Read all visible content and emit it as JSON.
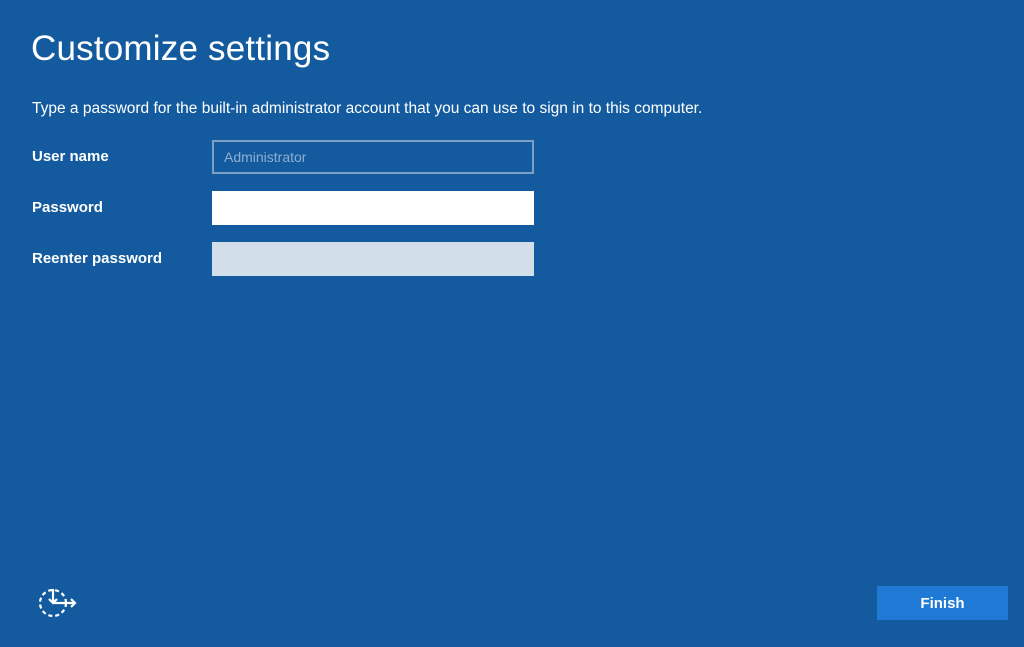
{
  "page": {
    "title": "Customize settings",
    "description": "Type a password for the built-in administrator account that you can use to sign in to this computer."
  },
  "form": {
    "username": {
      "label": "User name",
      "placeholder": "Administrator",
      "value": ""
    },
    "password": {
      "label": "Password",
      "value": ""
    },
    "reenter_password": {
      "label": "Reenter password",
      "value": ""
    }
  },
  "footer": {
    "ease_of_access_icon": "ease-of-access-icon",
    "finish_label": "Finish"
  },
  "colors": {
    "background": "#135b9e",
    "button": "#1f7ad6",
    "text": "#ffffff"
  }
}
